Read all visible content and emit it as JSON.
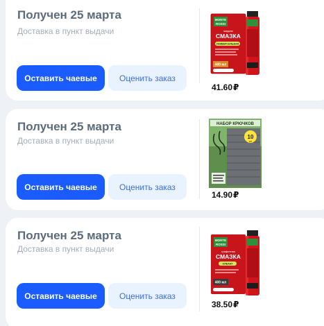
{
  "orders": [
    {
      "status": "Получен 25 марта",
      "delivery": "Доставка в пункт выдачи",
      "tip_button": "Оставить чаевые",
      "rate_button": "Оценить заказ",
      "price": "41.60",
      "currency": "₽",
      "product": {
        "brand_line1": "MONTE",
        "brand_line2": "ROSSI",
        "name_line1": "жидкая",
        "name_line2": "СМАЗКА",
        "tag": "УНИВЕРСАЛЬНАЯ",
        "volume": "400 мл"
      }
    },
    {
      "status": "Получен 25 марта",
      "delivery": "Доставка в пункт выдачи",
      "tip_button": "Оставить чаевые",
      "rate_button": "Оценить заказ",
      "price": "14.90",
      "currency": "₽",
      "product": {
        "header": "НАБОР КРЮЧКОВ",
        "count": "10",
        "unit": "шт"
      }
    },
    {
      "status": "Получен 25 марта",
      "delivery": "Доставка в пункт выдачи",
      "tip_button": "Оставить чаевые",
      "rate_button": "Оценить заказ",
      "price": "38.50",
      "currency": "₽",
      "product": {
        "brand_line1": "MONTE",
        "brand_line2": "ROSSI",
        "name_line1": "графитная",
        "name_line2": "СМАЗКА",
        "tag": "ОЛЕАНТ",
        "volume": "400 мл"
      }
    }
  ],
  "colors": {
    "primary": "#1a5cff",
    "secondary_bg": "#e9f2ff",
    "secondary_text": "#3d6ed8",
    "title": "#5b6b7b",
    "subtitle": "#a3adb8",
    "product_red": "#c8141b"
  }
}
